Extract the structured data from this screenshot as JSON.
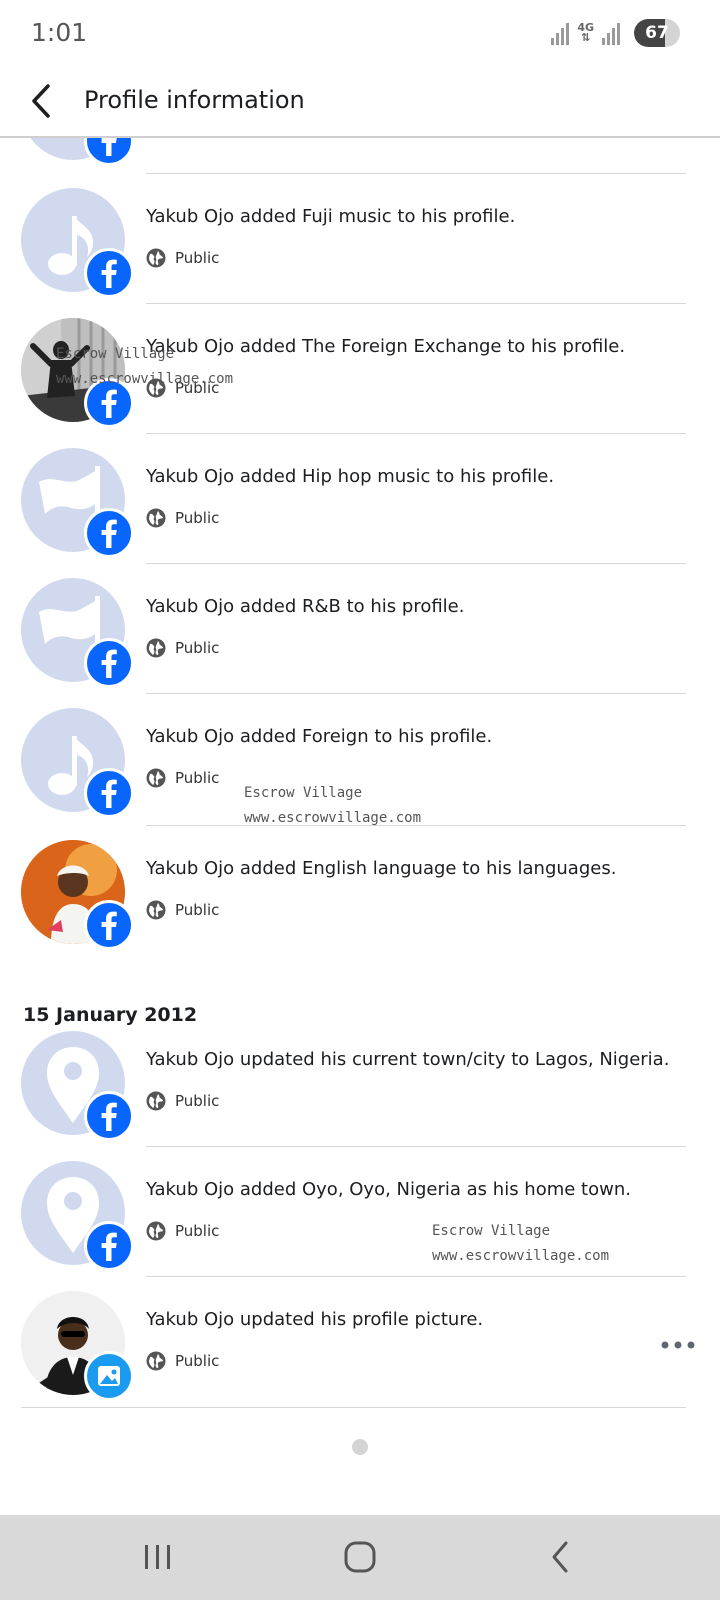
{
  "status_bar": {
    "time": "1:01",
    "network": "4G",
    "battery": "67",
    "battery_fraction": 0.67
  },
  "header": {
    "title": "Profile information",
    "back_icon": "chevron-left-icon"
  },
  "audience_label": "Public",
  "date_group": "15 January 2012",
  "items": [
    {
      "text": "Yakub Ojo added Fuji music to his profile.",
      "avatar": "music-note-icon",
      "badge": "facebook-icon"
    },
    {
      "text": "Yakub Ojo added The Foreign Exchange to his profile.",
      "avatar": "photo",
      "badge": "facebook-icon"
    },
    {
      "text": "Yakub Ojo added Hip hop music to his profile.",
      "avatar": "flag-icon",
      "badge": "facebook-icon"
    },
    {
      "text": "Yakub Ojo added R&B to his profile.",
      "avatar": "flag-icon",
      "badge": "facebook-icon"
    },
    {
      "text": "Yakub Ojo added Foreign to his profile.",
      "avatar": "music-note-icon",
      "badge": "facebook-icon"
    },
    {
      "text": "Yakub Ojo added English language to his languages.",
      "avatar": "photo",
      "badge": "facebook-icon"
    },
    {
      "text": "Yakub Ojo updated his current town/city to Lagos, Nigeria.",
      "avatar": "location-pin-icon",
      "badge": "facebook-icon"
    },
    {
      "text": "Yakub Ojo added Oyo, Oyo, Nigeria as his home town.",
      "avatar": "location-pin-icon",
      "badge": "facebook-icon"
    },
    {
      "text": "Yakub Ojo updated his profile picture.",
      "avatar": "photo",
      "badge": "image-icon"
    }
  ],
  "watermark": {
    "line1": "Escrow Village",
    "line2": "www.escrowvillage.com"
  },
  "colors": {
    "facebook_blue": "#0866ff",
    "avatar_placeholder": "#d1d9ee",
    "profile_picture_badge": "#1b9bf0"
  },
  "nav": {
    "recents": "recent-apps-icon",
    "home": "home-icon",
    "back": "back-icon"
  }
}
